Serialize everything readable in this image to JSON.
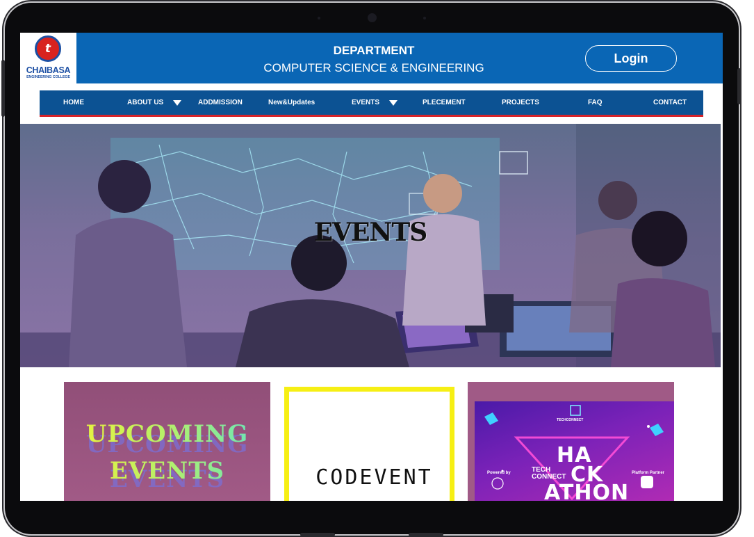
{
  "header": {
    "logo_name": "CHAIBASA",
    "logo_sub": "ENGINEERING COLLEGE",
    "logo_mark": "t",
    "dept_title": "DEPARTMENT",
    "dept_subtitle": "COMPUTER SCIENCE & ENGINEERING",
    "login_label": "Login"
  },
  "nav": {
    "items": [
      {
        "label": "HOME",
        "has_dropdown": false
      },
      {
        "label": "ABOUT US",
        "has_dropdown": true
      },
      {
        "label": "ADDMISSION",
        "has_dropdown": false
      },
      {
        "label": "New&Updates",
        "has_dropdown": false
      },
      {
        "label": "EVENTS",
        "has_dropdown": true
      },
      {
        "label": "PLECEMENT",
        "has_dropdown": false
      },
      {
        "label": "PROJECTS",
        "has_dropdown": false
      },
      {
        "label": "FAQ",
        "has_dropdown": false
      },
      {
        "label": "CONTACT",
        "has_dropdown": false
      }
    ]
  },
  "hero": {
    "title": "EVENTS"
  },
  "cards": {
    "upcoming": {
      "line1": "UPCOMING",
      "line2": "EVENTS"
    },
    "codevent": {
      "title": "CODEVENT"
    },
    "hackathon": {
      "brand": "TECHCONNECT",
      "line1": "HA",
      "line2": "CK",
      "line3": "ATHON",
      "center_tag": "TECH CONNECT",
      "left_tag": "Powered by",
      "right_tag": "Platform Partner"
    }
  },
  "colors": {
    "header_blue": "#0a66b5",
    "nav_blue": "#0c5293",
    "nav_accent": "#d6232a",
    "card_purple": "#a05a86",
    "code_yellow": "#f6ef14"
  }
}
